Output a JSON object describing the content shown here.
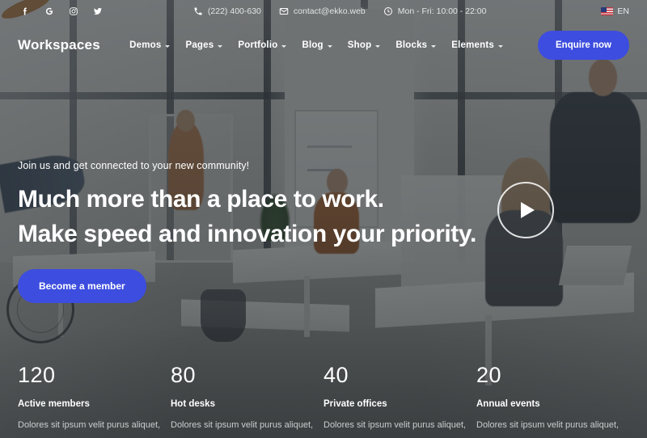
{
  "topbar": {
    "social": [
      {
        "name": "facebook-icon",
        "glyph": "f"
      },
      {
        "name": "google-icon",
        "glyph": "G"
      },
      {
        "name": "instagram-icon",
        "glyph": "▢"
      },
      {
        "name": "twitter-icon",
        "glyph": "✉"
      }
    ],
    "phone": "(222) 400-630",
    "email": "contact@ekko.web",
    "hours": "Mon - Fri: 10:00 - 22:00",
    "language": "EN"
  },
  "nav": {
    "logo": "Workspaces",
    "items": [
      {
        "label": "Demos"
      },
      {
        "label": "Pages"
      },
      {
        "label": "Portfolio"
      },
      {
        "label": "Blog"
      },
      {
        "label": "Shop"
      },
      {
        "label": "Blocks"
      },
      {
        "label": "Elements"
      }
    ],
    "cta": "Enquire now"
  },
  "hero": {
    "kicker": "Join us and get connected to your new community!",
    "heading_line1": "Much more than a place to work.",
    "heading_line2": "Make speed and innovation your priority.",
    "button": "Become a member"
  },
  "stats": [
    {
      "number": "120",
      "label": "Active members",
      "description": "Dolores sit ipsum velit purus aliquet,"
    },
    {
      "number": "80",
      "label": "Hot desks",
      "description": "Dolores sit ipsum velit purus aliquet,"
    },
    {
      "number": "40",
      "label": "Private offices",
      "description": "Dolores sit ipsum velit purus aliquet,"
    },
    {
      "number": "20",
      "label": "Annual events",
      "description": "Dolores sit ipsum velit purus aliquet,"
    }
  ],
  "colors": {
    "accent": "#3d4ddf",
    "overlay": "#212529",
    "text_light": "#ffffff",
    "text_muted": "#cbcdce"
  }
}
